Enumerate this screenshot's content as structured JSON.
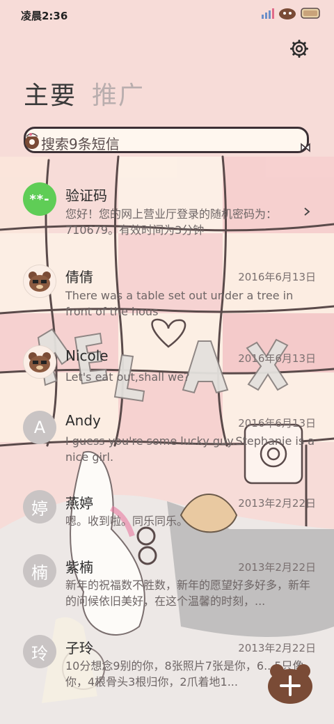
{
  "status_bar": {
    "time": "凌晨2:36"
  },
  "tabs": [
    {
      "label": "主要",
      "active": true
    },
    {
      "label": "推广",
      "active": false
    }
  ],
  "search": {
    "placeholder": "搜索9条短信"
  },
  "messages": [
    {
      "avatar_type": "verification",
      "avatar_text": "**-",
      "name": "验证码",
      "date": "",
      "preview": "您好！您的网上营业厅登录的随机密码为：710679。有效时间为3分钟"
    },
    {
      "avatar_type": "bear",
      "avatar_text": "",
      "name": "倩倩",
      "date": "2016年6月13日",
      "preview": "There was a table set out under a tree in front of the hous"
    },
    {
      "avatar_type": "bear",
      "avatar_text": "",
      "name": "Nicole",
      "date": "2016年6月13日",
      "preview": "Let's eat out,shall we?"
    },
    {
      "avatar_type": "letter",
      "avatar_text": "A",
      "name": "Andy",
      "date": "2016年6月13日",
      "preview": "I guess you're some lucky guy.Stephanie is a nice girl."
    },
    {
      "avatar_type": "letter",
      "avatar_text": "婷",
      "name": "燕婷",
      "date": "2013年2月22日",
      "preview": "嗯。收到啦。同乐同乐。"
    },
    {
      "avatar_type": "letter",
      "avatar_text": "楠",
      "name": "紫楠",
      "date": "2013年2月22日",
      "preview": "新年的祝福数不胜数，新年的愿望好多好多，新年的问候依旧美好，在这个温馨的时刻，..."
    },
    {
      "avatar_type": "letter",
      "avatar_text": "玲",
      "name": "子玲",
      "date": "2013年2月22日",
      "preview": "10分想念9别的你，8张照片7张是你，6...5只像你，4根骨头3根归你，2爪着地1..."
    }
  ],
  "wallpaper_text": "RELAX",
  "icons": {
    "settings": "gear-icon",
    "search": "donut-search-icon",
    "compose": "plus-icon",
    "chevron": "chevron-right-icon"
  },
  "colors": {
    "background": "#f7dcd8",
    "accent_green": "#5fcd56",
    "fab": "#7a4b36"
  }
}
